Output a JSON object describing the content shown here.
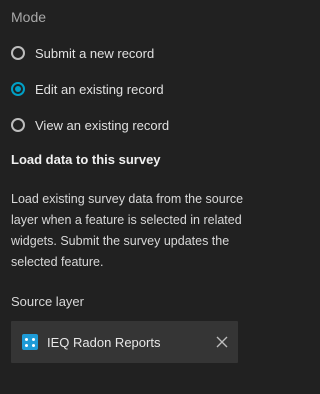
{
  "mode": {
    "label": "Mode",
    "options": [
      {
        "label": "Submit a new record",
        "checked": false
      },
      {
        "label": "Edit an existing record",
        "checked": true
      },
      {
        "label": "View an existing record",
        "checked": false
      }
    ]
  },
  "load_data": {
    "title": "Load data to this survey",
    "description": "Load existing survey data from the source layer when a feature is selected in related widgets. Submit the survey updates the selected feature."
  },
  "source_layer": {
    "label": "Source layer",
    "value": "IEQ Radon Reports",
    "icon": "feature-layer-icon",
    "clear_icon": "close-icon"
  },
  "colors": {
    "background": "#212121",
    "accent": "#00a0c6",
    "field_background": "#353535",
    "layer_icon": "#1e9bd7"
  }
}
